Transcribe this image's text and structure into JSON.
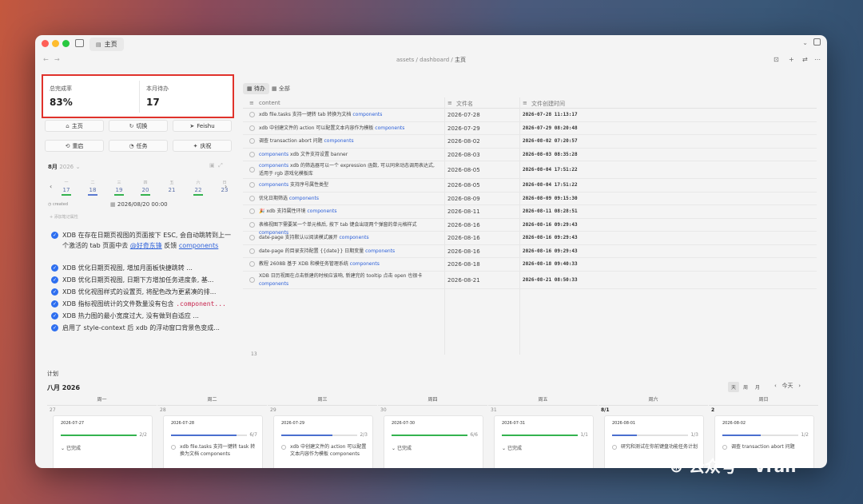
{
  "window": {
    "tab_title": "主页",
    "breadcrumb": [
      "assets",
      "dashboard",
      "主页"
    ]
  },
  "kpis": [
    {
      "label": "总完成率",
      "value": "83%"
    },
    {
      "label": "本月待办",
      "value": "17"
    }
  ],
  "quick_buttons": [
    {
      "label": "主页",
      "icon": "home-icon"
    },
    {
      "label": "切换",
      "icon": "switch-icon"
    },
    {
      "label": "Feishu",
      "icon": "send-icon"
    },
    {
      "label": "重启",
      "icon": "restart-icon"
    },
    {
      "label": "任务",
      "icon": "task-icon"
    },
    {
      "label": "庆祝",
      "icon": "celebrate-icon"
    }
  ],
  "calendar": {
    "month": "8月",
    "year": "2026",
    "days": [
      {
        "wk": "一",
        "d": "17",
        "color": "#34b34f"
      },
      {
        "wk": "二",
        "d": "18",
        "color": "#5a7ad0"
      },
      {
        "wk": "三",
        "d": "19",
        "color": "#34b34f"
      },
      {
        "wk": "四",
        "d": "20",
        "color": "#34b34f"
      },
      {
        "wk": "五",
        "d": "21",
        "color": ""
      },
      {
        "wk": "六",
        "d": "22",
        "color": "#34b34f"
      },
      {
        "wk": "日",
        "d": "23",
        "color": ""
      }
    ],
    "created_key": "created",
    "created_value": "2026/08/20 00:00",
    "add_attr": "添加笔记属性"
  },
  "todos": [
    {
      "pre": "XDB 在存在日期页视图的页面按下 ESC, 会自动跳转到上一个激活的 tab 页面中去 ",
      "link": "@好奇东锋",
      "mid": " 反馈 ",
      "link2": "components",
      "lines": 3
    },
    {
      "pre": "XDB 优化日期页视图, 增加月面板快捷跳转 ...",
      "lines": 1
    },
    {
      "pre": "XDB 优化日期页视图, 日期下方增加任务进度条, 基...",
      "lines": 1
    },
    {
      "pre": "XDB 优化视图样式的设置页, 将配色改为更紧凑的排...",
      "lines": 1
    },
    {
      "pre": "XDB 指标视图统计的文件数量没有包含 ",
      "code": ".component...",
      "lines": 1
    },
    {
      "pre": "XDB 热力图的最小宽度过大, 没有做到自适应 ...",
      "lines": 1
    },
    {
      "pre": "启用了 style-context 后 xdb 的浮动窗口背景色变成...",
      "lines": 1
    }
  ],
  "view_tabs": [
    "待办",
    "全部"
  ],
  "table": {
    "headers": [
      "content",
      "文件名",
      "文件创建时间"
    ],
    "rows": [
      {
        "text": "xdb file.tasks 支持一键转 tab 转换为文档 ",
        "link": "components",
        "file": "2026-07-28",
        "created": "2026-07-28 11:13:17"
      },
      {
        "text": "xdb 中创建文件的 action 可以配置文本内容作为模板 ",
        "link": "components",
        "file": "2026-07-29",
        "created": "2026-07-29 08:20:48"
      },
      {
        "text": "调查 transaction abort 问题 ",
        "link": "components",
        "file": "2026-08-02",
        "created": "2026-08-02 07:20:57"
      },
      {
        "text": "",
        "link": "components",
        "after": " xdb 文件支持设置 banner",
        "file": "2026-08-03",
        "created": "2026-08-03 08:35:28"
      },
      {
        "text": "",
        "link": "components",
        "after": " xdb 的筛选器可以一个 expression 函数, 可以同来动态调用表达式, 适用于 rgb 游戏化模板库",
        "file": "2026-08-05",
        "created": "2026-08-04 17:51:22"
      },
      {
        "text": "",
        "link": "components",
        "after": " 支持序号属性类型",
        "file": "2026-08-05",
        "created": "2026-08-04 17:51:22"
      },
      {
        "text": "优化日期筛选 ",
        "link": "components",
        "file": "2026-08-09",
        "created": "2026-08-09 09:15:30"
      },
      {
        "text": "🎉 xdb 支持属性环境 ",
        "link": "components",
        "file": "2026-08-11",
        "created": "2026-08-11 08:28:51"
      },
      {
        "text": "表格视图下需要某一个单元格后, 按下 tab 键会出现两个弹窗的单元格样式 ",
        "link": "components",
        "file": "2026-08-16",
        "created": "2026-08-16 09:29:43"
      },
      {
        "text": "date-page 支持默认以阅读模式展开 ",
        "link": "components",
        "file": "2026-08-16",
        "created": "2026-08-16 09:29:43"
      },
      {
        "text": "date-page 的目录支持配置 {{date}} 日期变量 ",
        "link": "components",
        "file": "2026-08-16",
        "created": "2026-08-16 09:29:43"
      },
      {
        "text": "教程 2608B 基于 XDB 和模任务管理系统 ",
        "link": "components",
        "file": "2026-08-18",
        "created": "2026-08-18 09:40:33"
      },
      {
        "text": "XDB 日历视图在点击新建的时候应该响, 新建完的 tooltip 点击 open 也很卡 ",
        "link": "components",
        "file": "2026-08-21",
        "created": "2026-08-21 08:50:33"
      }
    ],
    "count": "13"
  },
  "plan": {
    "title": "计划",
    "month_title": "八月 2026",
    "view_switch": [
      "天",
      "周",
      "月"
    ],
    "today": "今天",
    "weekdays": [
      "周一",
      "周二",
      "周三",
      "周四",
      "周五",
      "周六",
      "周日"
    ],
    "columns": [
      {
        "num": "27",
        "bold": false,
        "date": "2026-07-27",
        "progress": "2/2",
        "pct": 1.0,
        "color": "#34b34f",
        "item": "已完成",
        "done": true
      },
      {
        "num": "28",
        "bold": false,
        "date": "2026-07-28",
        "progress": "6/7",
        "pct": 0.86,
        "color": "#4a6fcf",
        "item": "xdb file.tasks 支持一键转 task 转换为文档 components",
        "done": false
      },
      {
        "num": "29",
        "bold": false,
        "date": "2026-07-29",
        "progress": "2/3",
        "pct": 0.67,
        "color": "#4a6fcf",
        "item": "xdb 中创建文件的 action 可以配置文本内容作为模板 components",
        "done": false
      },
      {
        "num": "30",
        "bold": false,
        "date": "2026-07-30",
        "progress": "6/6",
        "pct": 1.0,
        "color": "#34b34f",
        "item": "已完成",
        "done": true
      },
      {
        "num": "31",
        "bold": false,
        "date": "2026-07-31",
        "progress": "1/1",
        "pct": 1.0,
        "color": "#34b34f",
        "item": "已完成",
        "done": true
      },
      {
        "num": "8/1",
        "bold": true,
        "date": "2026-08-01",
        "progress": "1/3",
        "pct": 0.33,
        "color": "#4a6fcf",
        "item": "研究和测试在你前键盘功能任务计划",
        "done": false
      },
      {
        "num": "2",
        "bold": true,
        "date": "2026-08-02",
        "progress": "1/2",
        "pct": 0.5,
        "color": "#4a6fcf",
        "item": "调查 transaction abort 问题",
        "done": false
      }
    ]
  },
  "watermark": "公众号 · Vran"
}
